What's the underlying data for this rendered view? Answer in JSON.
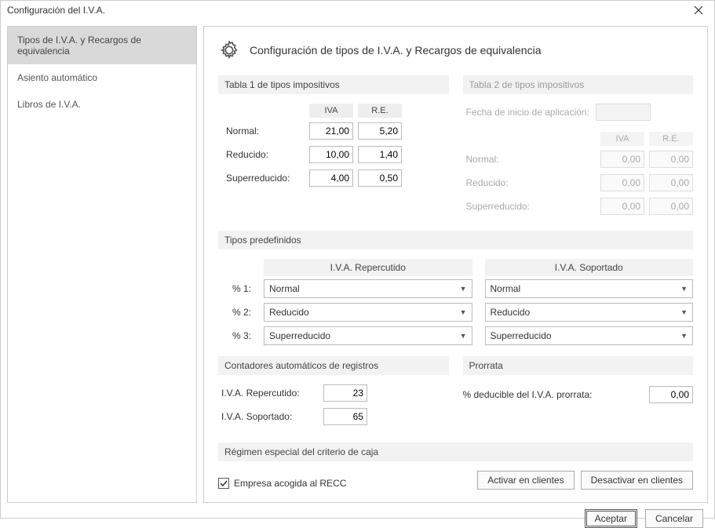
{
  "window": {
    "title": "Configuración del I.V.A."
  },
  "sidebar": {
    "items": [
      {
        "label": "Tipos de I.V.A. y Recargos de equivalencia"
      },
      {
        "label": "Asiento automático"
      },
      {
        "label": "Libros de I.V.A."
      }
    ]
  },
  "header": {
    "title": "Configuración de tipos de I.V.A. y Recargos de equivalencia"
  },
  "tabla1": {
    "title": "Tabla 1 de tipos impositivos",
    "head_iva": "IVA",
    "head_re": "R.E.",
    "rows": [
      {
        "label": "Normal:",
        "iva": "21,00",
        "re": "5,20"
      },
      {
        "label": "Reducido:",
        "iva": "10,00",
        "re": "1,40"
      },
      {
        "label": "Superreducido:",
        "iva": "4,00",
        "re": "0,50"
      }
    ]
  },
  "tabla2": {
    "title": "Tabla 2 de tipos impositivos",
    "date_label": "Fecha de inicio de aplicación:",
    "head_iva": "IVA",
    "head_re": "R.E.",
    "rows": [
      {
        "label": "Normal:",
        "iva": "0,00",
        "re": "0,00"
      },
      {
        "label": "Reducido:",
        "iva": "0,00",
        "re": "0,00"
      },
      {
        "label": "Superreducido:",
        "iva": "0,00",
        "re": "0,00"
      }
    ]
  },
  "predef": {
    "title": "Tipos predefinidos",
    "head_rep": "I.V.A. Repercutido",
    "head_sop": "I.V.A. Soportado",
    "rows": [
      {
        "label": "% 1:",
        "rep": "Normal",
        "sop": "Normal"
      },
      {
        "label": "% 2:",
        "rep": "Reducido",
        "sop": "Reducido"
      },
      {
        "label": "% 3:",
        "rep": "Superreducido",
        "sop": "Superreducido"
      }
    ]
  },
  "counters": {
    "title": "Contadores automáticos de registros",
    "rows": [
      {
        "label": "I.V.A. Repercutido:",
        "val": "23"
      },
      {
        "label": "I.V.A. Soportado:",
        "val": "65"
      }
    ]
  },
  "prorrata": {
    "title": "Prorrata",
    "label": "% deducible del I.V.A. prorrata:",
    "value": "0,00"
  },
  "recc": {
    "title": "Régimen especial del criterio de caja",
    "checkbox_label": "Empresa acogida al RECC",
    "checked": true,
    "btn_activate": "Activar en clientes",
    "btn_deactivate": "Desactivar en clientes"
  },
  "footer": {
    "accept": "Aceptar",
    "cancel": "Cancelar"
  }
}
